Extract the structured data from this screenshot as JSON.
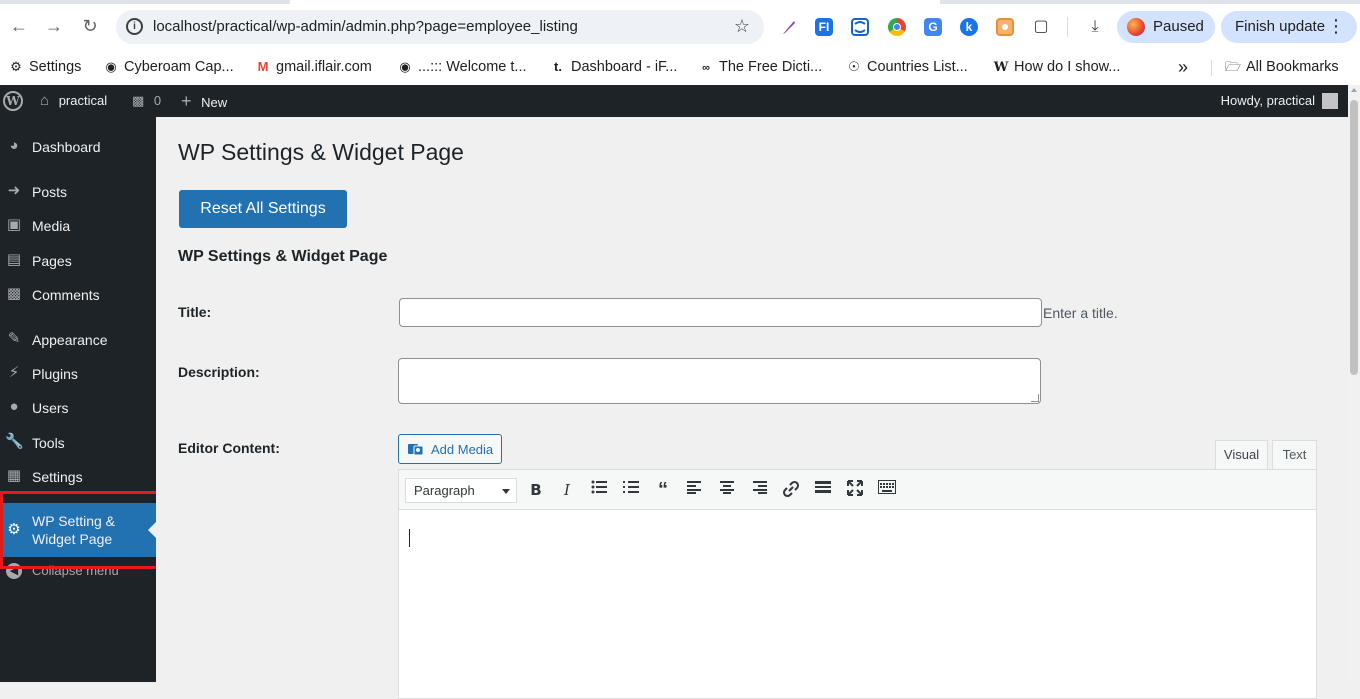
{
  "browser": {
    "url": "localhost/practical/wp-admin/admin.php?page=employee_listing",
    "profile_status": "Paused",
    "update_label": "Finish update",
    "icons": {
      "back": "back-arrow-icon",
      "forward": "forward-arrow-icon",
      "reload": "reload-icon",
      "info": "site-info-icon",
      "star": "bookmark-star-icon",
      "menu": "kebab-menu-icon"
    }
  },
  "bookmarks": {
    "items": [
      {
        "label": "Settings",
        "icon": "gear-icon"
      },
      {
        "label": "Cyberoam Cap...",
        "icon": "globe-icon"
      },
      {
        "label": "gmail.iflair.com",
        "icon": "gmail-icon"
      },
      {
        "label": "...::: Welcome t...",
        "icon": "globe-icon"
      },
      {
        "label": "Dashboard - iF...",
        "icon": "t-logo-icon"
      },
      {
        "label": "The Free Dicti...",
        "icon": "tfd-logo-icon"
      },
      {
        "label": "Countries List...",
        "icon": "compass-icon"
      },
      {
        "label": "How do I show...",
        "icon": "wikipedia-icon"
      }
    ],
    "overflow": "»",
    "all_label": "All Bookmarks"
  },
  "adminbar": {
    "site_name": "practical",
    "comments_count": "0",
    "new_label": "New",
    "howdy": "Howdy, practical"
  },
  "sidebar": {
    "items": [
      {
        "label": "Dashboard",
        "icon": "dashboard-icon"
      },
      {
        "label": "Posts",
        "icon": "pin-icon"
      },
      {
        "label": "Media",
        "icon": "media-icon"
      },
      {
        "label": "Pages",
        "icon": "pages-icon"
      },
      {
        "label": "Comments",
        "icon": "comment-icon"
      },
      {
        "label": "Appearance",
        "icon": "brush-icon"
      },
      {
        "label": "Plugins",
        "icon": "plugin-icon"
      },
      {
        "label": "Users",
        "icon": "user-icon"
      },
      {
        "label": "Tools",
        "icon": "wrench-icon"
      },
      {
        "label": "Settings",
        "icon": "settings-icon"
      },
      {
        "label": "WP Setting & Widget Page",
        "icon": "gear-icon"
      }
    ],
    "collapse_label": "Collapse menu",
    "highlight_color": "#e21b1b"
  },
  "main": {
    "page_title": "WP Settings & Widget Page",
    "reset_button": "Reset All Settings",
    "section_title": "WP Settings & Widget Page",
    "title_label": "Title:",
    "title_value": "",
    "title_hint": "Enter a title.",
    "description_label": "Description:",
    "description_value": "",
    "editor_label": "Editor Content:",
    "add_media": "Add Media",
    "tab_visual": "Visual",
    "tab_text": "Text",
    "format_select": "Paragraph",
    "editor_content": ""
  },
  "colors": {
    "admin_bar": "#1d2327",
    "accent": "#2271b1",
    "background": "#f0f0f1"
  }
}
